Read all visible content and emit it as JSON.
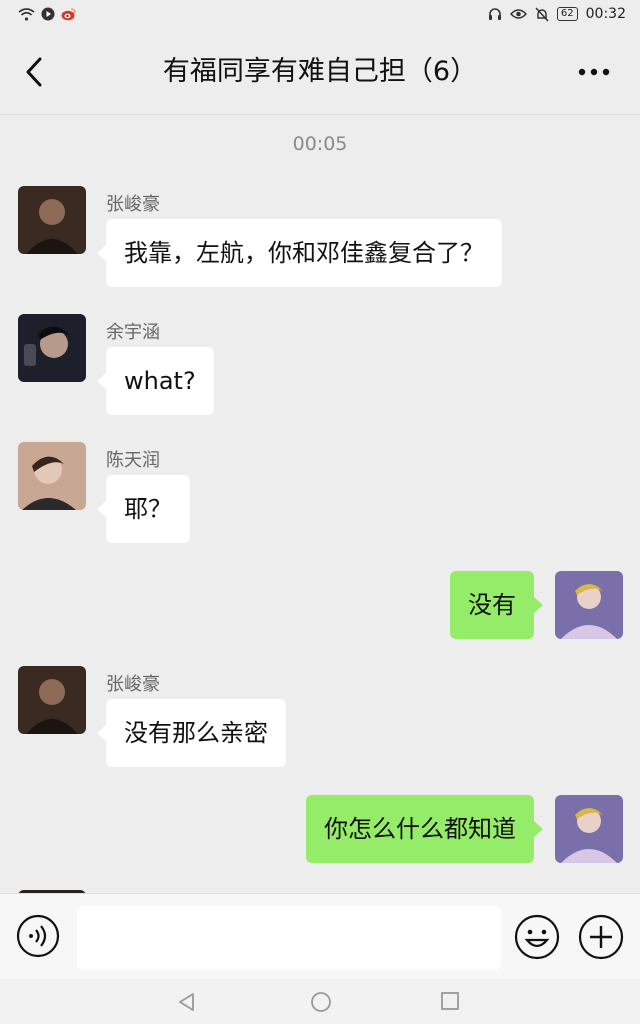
{
  "status_bar": {
    "time": "00:32",
    "battery": "62"
  },
  "header": {
    "title": "有福同享有难自己担（6）"
  },
  "chat": {
    "timestamp": "00:05",
    "messages": [
      {
        "sender": "张峻豪",
        "text": "我靠，左航，你和邓佳鑫复合了？",
        "direction": "in",
        "avatar_colors": [
          "#3a2a22",
          "#8c6a55"
        ]
      },
      {
        "sender": "余宇涵",
        "text": "what?",
        "direction": "in",
        "avatar_colors": [
          "#1d1f2a",
          "#b89a8a"
        ]
      },
      {
        "sender": "陈天润",
        "text": "耶？",
        "direction": "in",
        "avatar_colors": [
          "#5a3a2a",
          "#e2c8b8"
        ]
      },
      {
        "sender": "",
        "text": "没有",
        "direction": "out",
        "avatar_colors": [
          "#7a6fa8",
          "#d6c7e6"
        ]
      },
      {
        "sender": "张峻豪",
        "text": "没有那么亲密",
        "direction": "in",
        "avatar_colors": [
          "#3a2a22",
          "#8c6a55"
        ]
      },
      {
        "sender": "",
        "text": "你怎么什么都知道",
        "direction": "out",
        "avatar_colors": [
          "#7a6fa8",
          "#d6c7e6"
        ]
      }
    ]
  },
  "colors": {
    "background": "#ededed",
    "outgoing_bubble": "#95ec69",
    "incoming_bubble": "#ffffff"
  },
  "icons": [
    "wifi-icon",
    "play-icon",
    "weibo-icon",
    "headphones-icon",
    "eye-icon",
    "mute-bell-icon",
    "back-icon",
    "more-icon",
    "voice-icon",
    "emoji-icon",
    "plus-icon",
    "nav-back-icon",
    "nav-home-icon",
    "nav-recent-icon"
  ]
}
